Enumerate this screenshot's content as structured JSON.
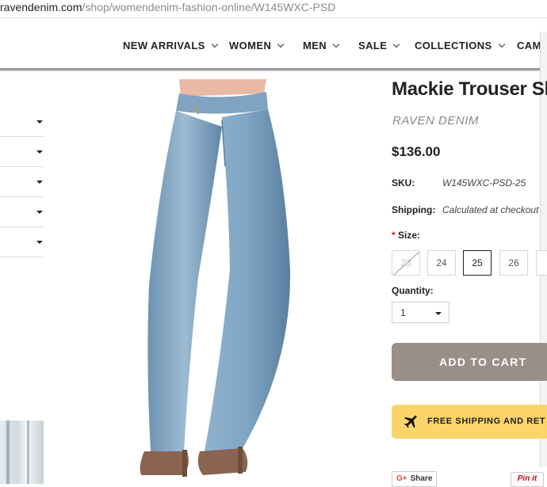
{
  "browser": {
    "url_host": "ravendenim.com",
    "url_path": "/shop/womendenim-fashion-online/W145WXC-PSD"
  },
  "nav": {
    "items": [
      "NEW ARRIVALS",
      "WOMEN",
      "MEN",
      "SALE",
      "COLLECTIONS",
      "CAMP"
    ]
  },
  "product": {
    "title": "Mackie Trouser Sli",
    "brand": "RAVEN DENIM",
    "price": "$136.00",
    "sku_label": "SKU:",
    "sku_value": "W145WXC-PSD-25",
    "shipping_label": "Shipping:",
    "shipping_value": "Calculated at checkout",
    "size_required_mark": "*",
    "size_label": "Size:",
    "sizes": [
      "23",
      "24",
      "25",
      "26"
    ],
    "selected_size": "25",
    "unavailable_size": "23",
    "quantity_label": "Quantity:",
    "quantity_value": "1",
    "add_to_cart": "ADD TO CART",
    "shipping_banner": "FREE SHIPPING AND RET"
  },
  "social": {
    "gplus_share": "Share",
    "gplus_icon": "G+",
    "pin_it": "Pin it"
  },
  "colors": {
    "add_to_cart_bg": "#9a8e89",
    "shipping_banner_bg": "#fbd46a",
    "denim": "#7ea7c7"
  }
}
